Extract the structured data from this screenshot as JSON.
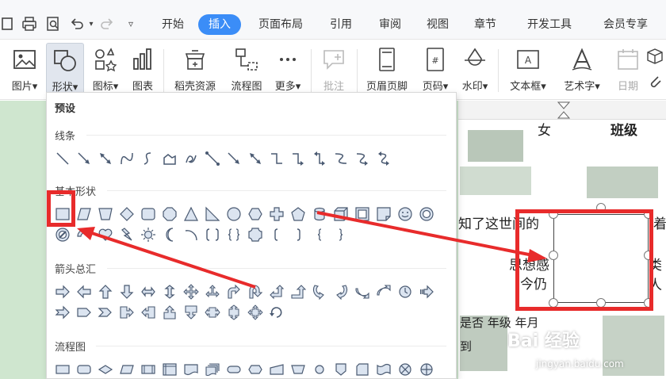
{
  "quick_access": [
    "save",
    "print",
    "print-preview",
    "undo",
    "redo",
    "more"
  ],
  "tabs": [
    "开始",
    "插入",
    "页面布局",
    "引用",
    "审阅",
    "视图",
    "章节",
    "开发工具",
    "会员专享"
  ],
  "active_tab": "插入",
  "ribbon": {
    "picture": "图片",
    "shapes": "形状",
    "icons": "图标",
    "chart": "图表",
    "docer": "稻壳资源",
    "flowchart": "流程图",
    "more": "更多",
    "comment": "批注",
    "header_footer": "页眉页脚",
    "page_number": "页码",
    "watermark": "水印",
    "textbox": "文本框",
    "wordart": "艺术字",
    "date": "日期"
  },
  "shape_panel": {
    "title": "预设",
    "sections": [
      "线条",
      "基本形状",
      "箭头总汇",
      "流程图"
    ]
  },
  "document": {
    "header_cells": [
      "女",
      "班级"
    ],
    "line1": "知了这世间的",
    "line2": "着",
    "line3": "思想感",
    "line4": "今仍",
    "line5": "类人",
    "row1": "是否   年级   年月",
    "fragment": "到"
  },
  "watermark": {
    "brand": "Bai 经验",
    "url": "jingyan.baidu.com"
  },
  "colors": {
    "accent": "#3b8df7",
    "annotation": "#e82b2b",
    "doc_bg": "#cfe6cf"
  }
}
